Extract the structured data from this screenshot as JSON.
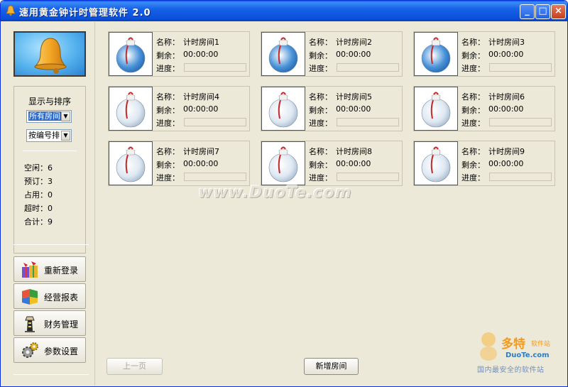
{
  "window": {
    "title": "速用黄金钟计时管理软件 2.0",
    "controls": {
      "minimize": "_",
      "maximize": "□",
      "close": "×"
    }
  },
  "sidebar": {
    "sort_title": "显示与排序",
    "room_filter": "所有房间",
    "sort_order": "按编号排",
    "stats": [
      {
        "label": "空闲",
        "value": "6"
      },
      {
        "label": "预订",
        "value": "3"
      },
      {
        "label": "占用",
        "value": "0"
      },
      {
        "label": "超时",
        "value": "0"
      },
      {
        "label": "合计",
        "value": "9"
      }
    ],
    "buttons": [
      {
        "label": "重新登录",
        "icon": "gift-icon"
      },
      {
        "label": "经营报表",
        "icon": "report-icon"
      },
      {
        "label": "财务管理",
        "icon": "lighthouse-icon"
      },
      {
        "label": "参数设置",
        "icon": "gears-icon"
      }
    ]
  },
  "rooms": {
    "labels": {
      "name": "名称：",
      "remaining": "剩余：",
      "progress": "进度："
    },
    "items": [
      {
        "name": "计时房间1",
        "remaining": "00:00:00",
        "progress": 0,
        "state": "booked"
      },
      {
        "name": "计时房间2",
        "remaining": "00:00:00",
        "progress": 0,
        "state": "booked"
      },
      {
        "name": "计时房间3",
        "remaining": "00:00:00",
        "progress": 0,
        "state": "booked"
      },
      {
        "name": "计时房间4",
        "remaining": "00:00:00",
        "progress": 0,
        "state": "free"
      },
      {
        "name": "计时房间5",
        "remaining": "00:00:00",
        "progress": 0,
        "state": "free"
      },
      {
        "name": "计时房间6",
        "remaining": "00:00:00",
        "progress": 0,
        "state": "free"
      },
      {
        "name": "计时房间7",
        "remaining": "00:00:00",
        "progress": 0,
        "state": "free"
      },
      {
        "name": "计时房间8",
        "remaining": "00:00:00",
        "progress": 0,
        "state": "free"
      },
      {
        "name": "计时房间9",
        "remaining": "00:00:00",
        "progress": 0,
        "state": "free"
      }
    ]
  },
  "footer": {
    "prev_page": "上一页",
    "add_room": "新增房间"
  },
  "watermark": "www.DuoTe.com",
  "corner_logo": {
    "name": "多特",
    "subtitle": "软件站",
    "domain": "DuoTe.com",
    "tagline": "国内最安全的软件站"
  },
  "colors": {
    "titlebar": "#0b4fd8",
    "window_bg": "#ece9d8",
    "select_highlight": "#316ac5",
    "booked_ornament": "#4a93d8",
    "free_ornament": "#dfe8f2"
  }
}
